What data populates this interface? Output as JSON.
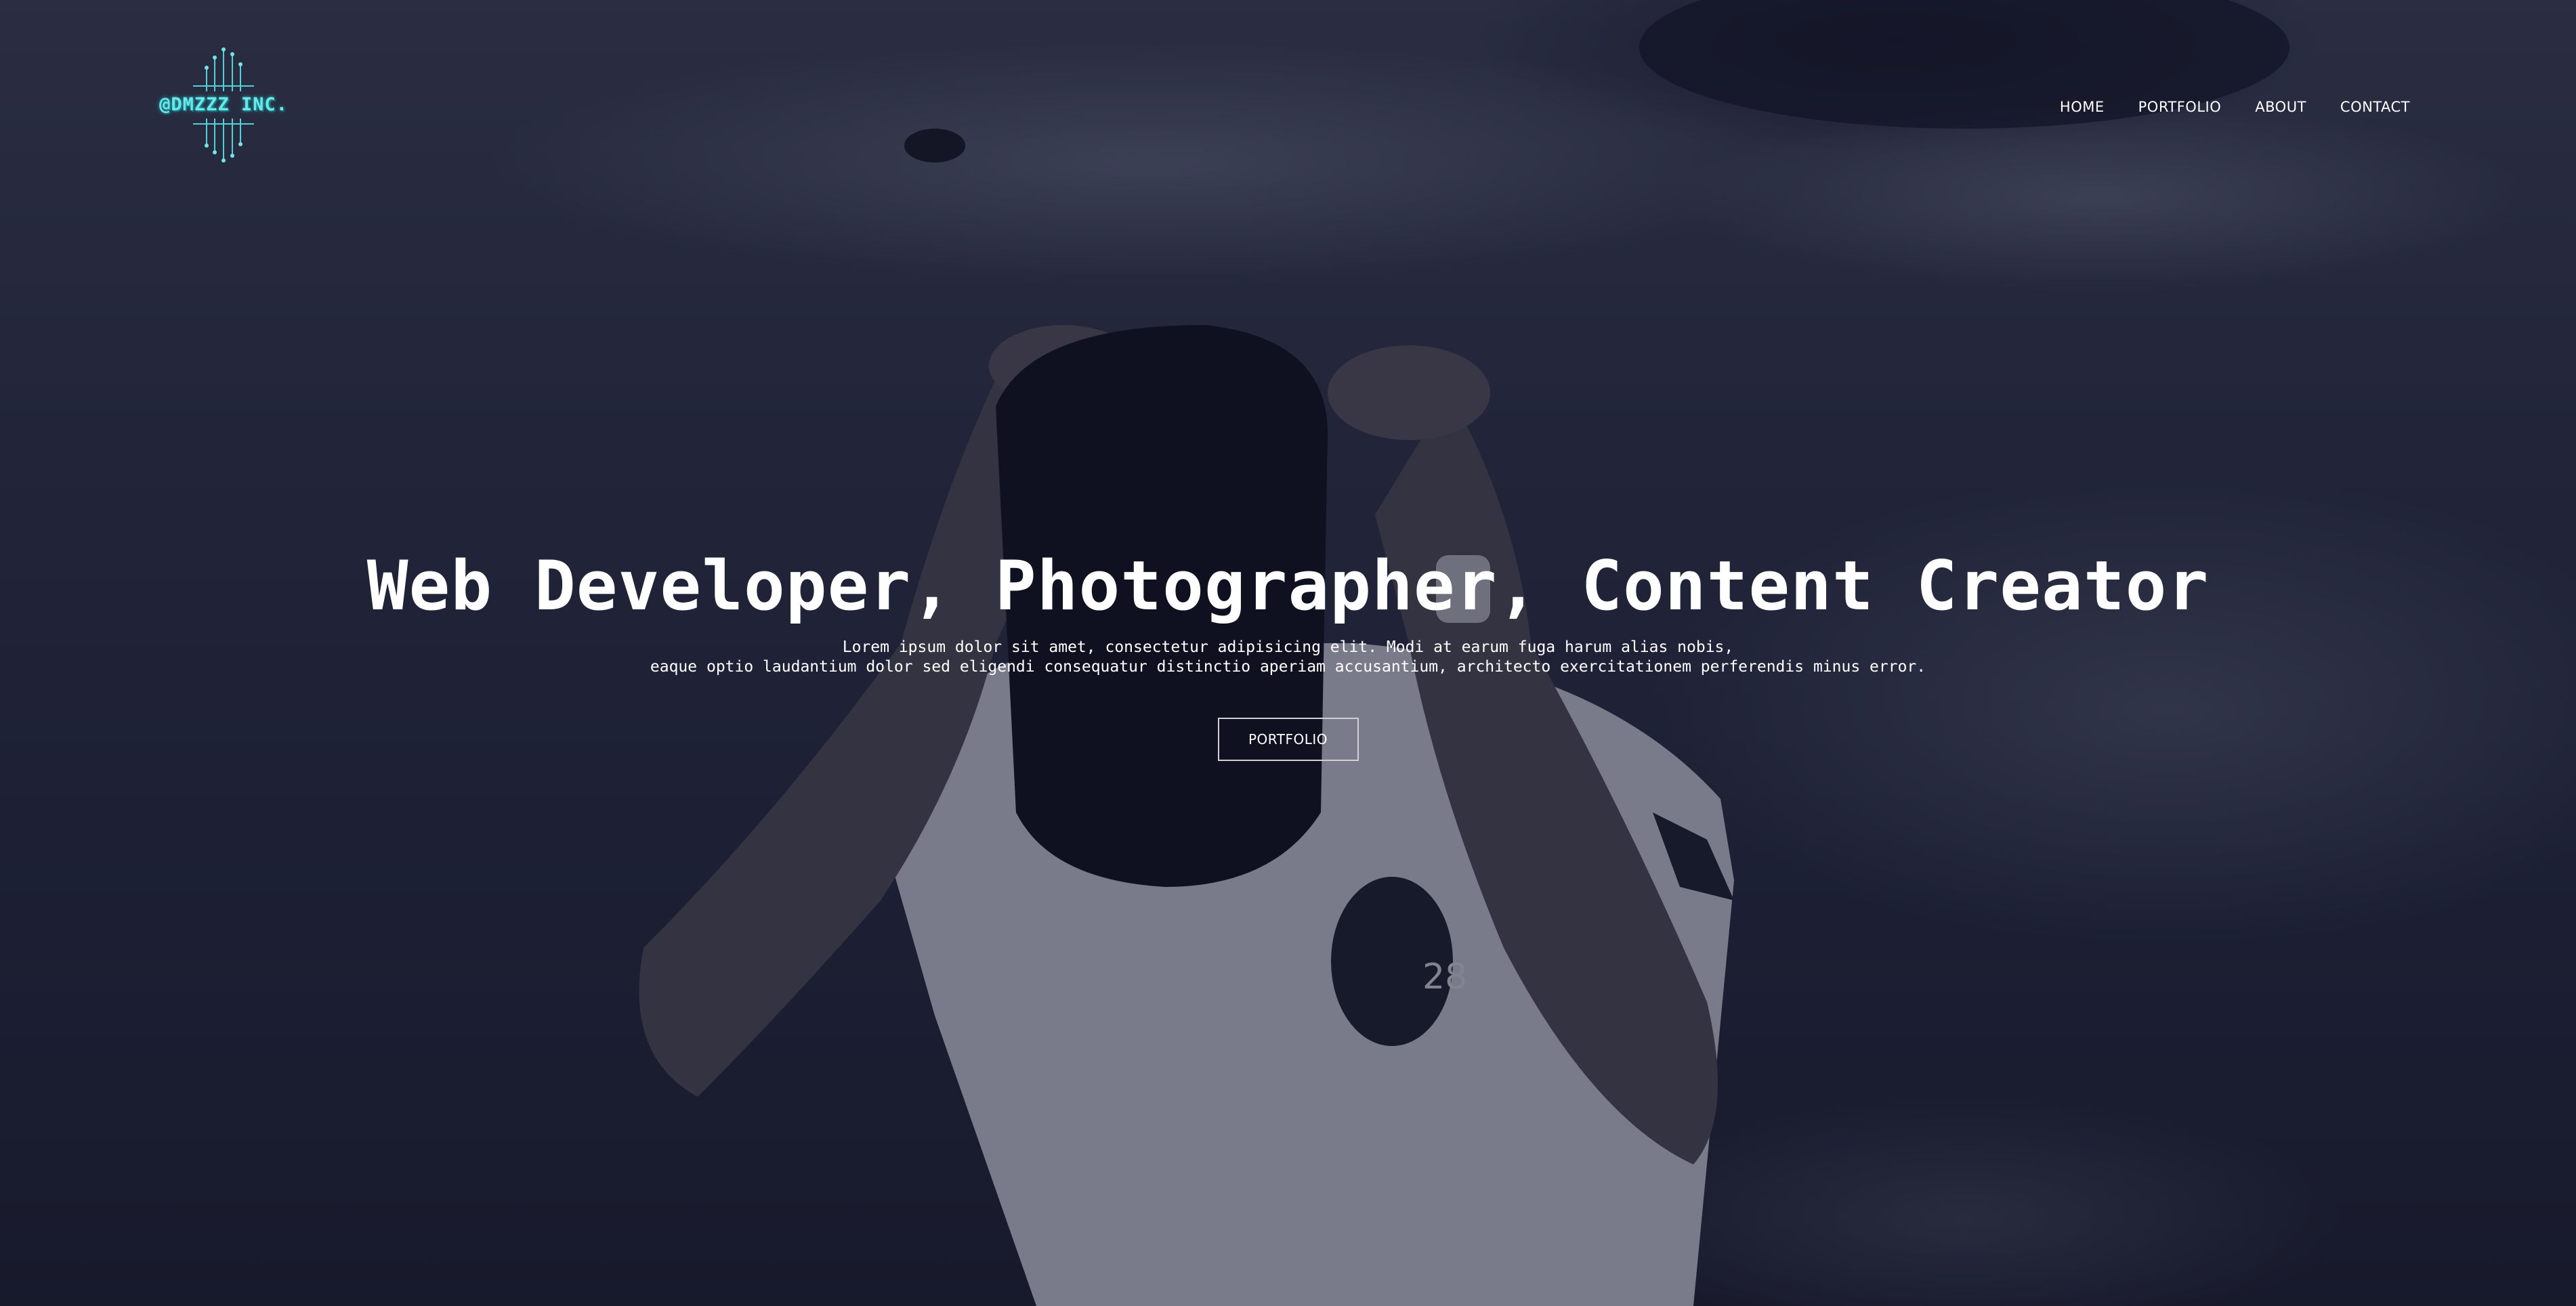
{
  "brand": {
    "logo_text": "@DMZZZ INC.",
    "accent_color": "#6fe6e6"
  },
  "nav": {
    "items": [
      {
        "label": "HOME"
      },
      {
        "label": "PORTFOLIO"
      },
      {
        "label": "ABOUT"
      },
      {
        "label": "CONTACT"
      }
    ]
  },
  "hero": {
    "headline": "Web Developer, Photographer, Content Creator",
    "subtitle_line1": "Lorem ipsum dolor sit amet, consectetur adipisicing elit. Modi at earum fuga harum alias nobis,",
    "subtitle_line2": "eaque optio laudantium dolor sed eligendi consequatur distinctio aperiam accusantium, architecto exercitationem perferendis minus error.",
    "cta_label": "PORTFOLIO",
    "background_image": "person-covering-face-with-cap-by-the-sea",
    "shirt_number": "28"
  }
}
